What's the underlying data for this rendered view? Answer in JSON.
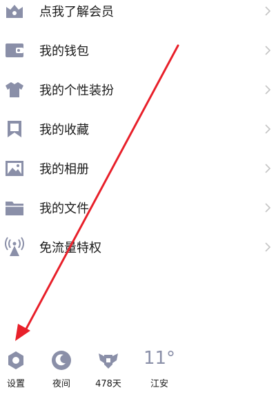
{
  "menu": {
    "items": [
      {
        "label": "点我了解会员",
        "icon": "crown-icon"
      },
      {
        "label": "我的钱包",
        "icon": "wallet-icon"
      },
      {
        "label": "我的个性装扮",
        "icon": "tshirt-icon"
      },
      {
        "label": "我的收藏",
        "icon": "bookmark-icon"
      },
      {
        "label": "我的相册",
        "icon": "photo-icon"
      },
      {
        "label": "我的文件",
        "icon": "folder-icon"
      },
      {
        "label": "免流量特权",
        "icon": "signal-tower-icon"
      }
    ]
  },
  "bottom_bar": {
    "settings_label": "设置",
    "night_label": "夜间",
    "days_label": "478天",
    "temperature": "11°",
    "location_label": "江安"
  },
  "colors": {
    "icon": "#8a8fa8",
    "text": "#1a1a1a",
    "chevron": "#c4c4c4",
    "annotation_arrow": "#e8202a"
  }
}
